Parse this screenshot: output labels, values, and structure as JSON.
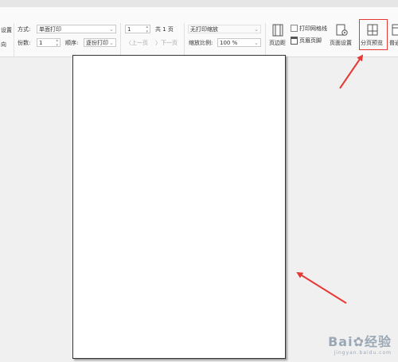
{
  "toolbar": {
    "left_partial_1": "设置",
    "left_partial_2": "向",
    "mode_label": "方式:",
    "mode_value": "单面打印",
    "copies_label": "份数:",
    "copies_value": "1",
    "order_label": "顺序:",
    "order_value": "逐份打印",
    "page_input": "1",
    "total_pages": "共 1 页",
    "prev_page": "上一页",
    "next_page": "下一页",
    "scale_mode": "无打印缩放",
    "zoom_label": "缩放比例:",
    "zoom_value": "100 %",
    "margins_label": "页边距",
    "print_gridlines_label": "打印网格线",
    "header_footer_label": "页眉页脚",
    "page_setup_label": "页面设置",
    "page_break_preview_label": "分页预览",
    "normal_view_partial": "普通"
  },
  "watermark": {
    "brand": "Bai",
    "brand_cn": "经验",
    "url": "jingyan.baidu.com"
  },
  "colors": {
    "arrow": "#e53935",
    "highlight": "#e53935"
  }
}
